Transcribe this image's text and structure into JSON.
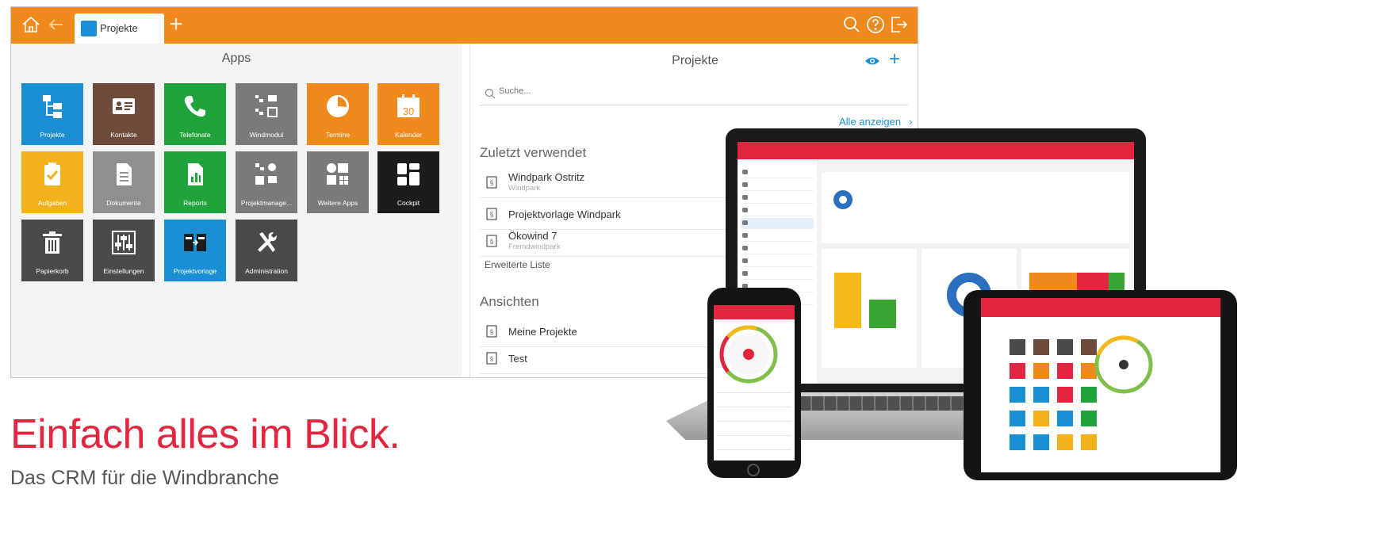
{
  "colors": {
    "orange": "#f08a1d",
    "brand_red": "#e3263f",
    "accent_blue": "#1a8fd3"
  },
  "topbar": {
    "tab_label": "Projekte",
    "icons": [
      "home-icon",
      "back-arrow-icon",
      "search-icon",
      "help-icon",
      "logout-icon"
    ]
  },
  "apps": {
    "title": "Apps",
    "tiles": [
      {
        "label": "Projekte",
        "color": "#1a8fd3",
        "icon": "hierarchy-icon"
      },
      {
        "label": "Kontakte",
        "color": "#6d4c3b",
        "icon": "contact-card-icon"
      },
      {
        "label": "Telefonate",
        "color": "#1fa33a",
        "icon": "phone-icon"
      },
      {
        "label": "Windmodul",
        "color": "#7a7a7a",
        "icon": "module-grid-icon"
      },
      {
        "label": "Termine",
        "color": "#f08a1d",
        "icon": "clock-icon"
      },
      {
        "label": "Kalender",
        "color": "#f08a1d",
        "icon": "calendar-icon"
      },
      {
        "label": "Aufgaben",
        "color": "#f1b21c",
        "icon": "clipboard-check-icon"
      },
      {
        "label": "Dokumente",
        "color": "#8f8f8f",
        "icon": "document-icon"
      },
      {
        "label": "Reports",
        "color": "#1fa33a",
        "icon": "report-chart-icon"
      },
      {
        "label": "Projektmanage...",
        "color": "#7a7a7a",
        "icon": "project-management-icon"
      },
      {
        "label": "Weitere Apps",
        "color": "#7a7a7a",
        "icon": "more-apps-icon"
      },
      {
        "label": "Cockpit",
        "color": "#1c1c1c",
        "icon": "dashboard-icon"
      },
      {
        "label": "Papierkorb",
        "color": "#4a4a4a",
        "icon": "trash-icon"
      },
      {
        "label": "Einstellungen",
        "color": "#4a4a4a",
        "icon": "sliders-icon"
      },
      {
        "label": "Projektvorlage",
        "color": "#1a8fd3",
        "icon": "template-icon"
      },
      {
        "label": "Administration",
        "color": "#4a4a4a",
        "icon": "tools-icon"
      }
    ]
  },
  "projects_panel": {
    "title": "Projekte",
    "search_placeholder": "Suche...",
    "show_all": "Alle anzeigen",
    "recent_heading": "Zuletzt verwendet",
    "recent": [
      {
        "title": "Windpark Ostritz",
        "subtitle": "Windpark"
      },
      {
        "title": "Projektvorlage Windpark",
        "subtitle": ""
      },
      {
        "title": "Ökowind 7",
        "subtitle": "Fremdwindpark"
      }
    ],
    "extended_list": "Erweiterte Liste",
    "views_heading": "Ansichten",
    "views": [
      {
        "title": "Meine Projekte"
      },
      {
        "title": "Test"
      }
    ]
  },
  "slogan": "Einfach alles im Blick.",
  "subslogan": "Das CRM für die Windbranche"
}
